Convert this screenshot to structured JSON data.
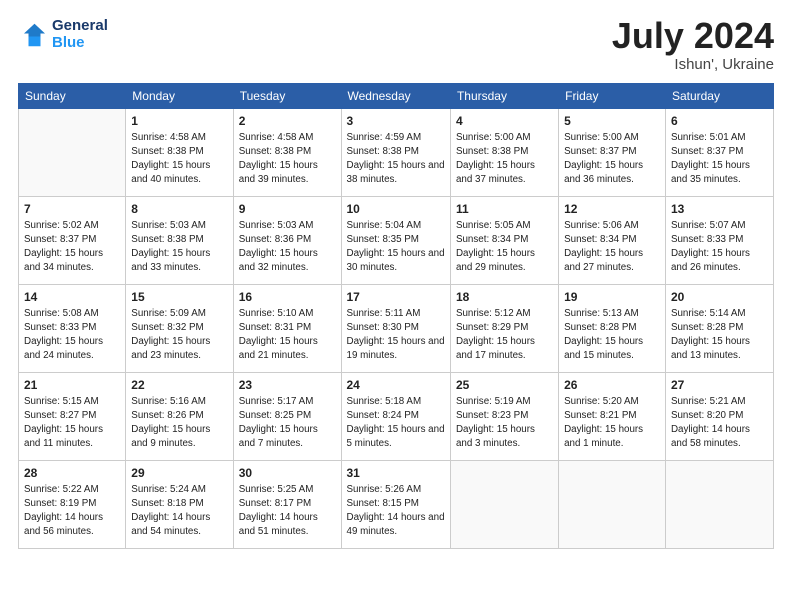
{
  "header": {
    "logo_line1": "General",
    "logo_line2": "Blue",
    "month": "July 2024",
    "location": "Ishun', Ukraine"
  },
  "weekdays": [
    "Sunday",
    "Monday",
    "Tuesday",
    "Wednesday",
    "Thursday",
    "Friday",
    "Saturday"
  ],
  "weeks": [
    [
      {
        "day": "",
        "empty": true
      },
      {
        "day": "1",
        "sunrise": "4:58 AM",
        "sunset": "8:38 PM",
        "daylight": "15 hours and 40 minutes."
      },
      {
        "day": "2",
        "sunrise": "4:58 AM",
        "sunset": "8:38 PM",
        "daylight": "15 hours and 39 minutes."
      },
      {
        "day": "3",
        "sunrise": "4:59 AM",
        "sunset": "8:38 PM",
        "daylight": "15 hours and 38 minutes."
      },
      {
        "day": "4",
        "sunrise": "5:00 AM",
        "sunset": "8:38 PM",
        "daylight": "15 hours and 37 minutes."
      },
      {
        "day": "5",
        "sunrise": "5:00 AM",
        "sunset": "8:37 PM",
        "daylight": "15 hours and 36 minutes."
      },
      {
        "day": "6",
        "sunrise": "5:01 AM",
        "sunset": "8:37 PM",
        "daylight": "15 hours and 35 minutes."
      }
    ],
    [
      {
        "day": "7",
        "sunrise": "5:02 AM",
        "sunset": "8:37 PM",
        "daylight": "15 hours and 34 minutes."
      },
      {
        "day": "8",
        "sunrise": "5:03 AM",
        "sunset": "8:38 PM",
        "daylight": "15 hours and 33 minutes."
      },
      {
        "day": "9",
        "sunrise": "5:03 AM",
        "sunset": "8:36 PM",
        "daylight": "15 hours and 32 minutes."
      },
      {
        "day": "10",
        "sunrise": "5:04 AM",
        "sunset": "8:35 PM",
        "daylight": "15 hours and 30 minutes."
      },
      {
        "day": "11",
        "sunrise": "5:05 AM",
        "sunset": "8:34 PM",
        "daylight": "15 hours and 29 minutes."
      },
      {
        "day": "12",
        "sunrise": "5:06 AM",
        "sunset": "8:34 PM",
        "daylight": "15 hours and 27 minutes."
      },
      {
        "day": "13",
        "sunrise": "5:07 AM",
        "sunset": "8:33 PM",
        "daylight": "15 hours and 26 minutes."
      }
    ],
    [
      {
        "day": "14",
        "sunrise": "5:08 AM",
        "sunset": "8:33 PM",
        "daylight": "15 hours and 24 minutes."
      },
      {
        "day": "15",
        "sunrise": "5:09 AM",
        "sunset": "8:32 PM",
        "daylight": "15 hours and 23 minutes."
      },
      {
        "day": "16",
        "sunrise": "5:10 AM",
        "sunset": "8:31 PM",
        "daylight": "15 hours and 21 minutes."
      },
      {
        "day": "17",
        "sunrise": "5:11 AM",
        "sunset": "8:30 PM",
        "daylight": "15 hours and 19 minutes."
      },
      {
        "day": "18",
        "sunrise": "5:12 AM",
        "sunset": "8:29 PM",
        "daylight": "15 hours and 17 minutes."
      },
      {
        "day": "19",
        "sunrise": "5:13 AM",
        "sunset": "8:28 PM",
        "daylight": "15 hours and 15 minutes."
      },
      {
        "day": "20",
        "sunrise": "5:14 AM",
        "sunset": "8:28 PM",
        "daylight": "15 hours and 13 minutes."
      }
    ],
    [
      {
        "day": "21",
        "sunrise": "5:15 AM",
        "sunset": "8:27 PM",
        "daylight": "15 hours and 11 minutes."
      },
      {
        "day": "22",
        "sunrise": "5:16 AM",
        "sunset": "8:26 PM",
        "daylight": "15 hours and 9 minutes."
      },
      {
        "day": "23",
        "sunrise": "5:17 AM",
        "sunset": "8:25 PM",
        "daylight": "15 hours and 7 minutes."
      },
      {
        "day": "24",
        "sunrise": "5:18 AM",
        "sunset": "8:24 PM",
        "daylight": "15 hours and 5 minutes."
      },
      {
        "day": "25",
        "sunrise": "5:19 AM",
        "sunset": "8:23 PM",
        "daylight": "15 hours and 3 minutes."
      },
      {
        "day": "26",
        "sunrise": "5:20 AM",
        "sunset": "8:21 PM",
        "daylight": "15 hours and 1 minute."
      },
      {
        "day": "27",
        "sunrise": "5:21 AM",
        "sunset": "8:20 PM",
        "daylight": "14 hours and 58 minutes."
      }
    ],
    [
      {
        "day": "28",
        "sunrise": "5:22 AM",
        "sunset": "8:19 PM",
        "daylight": "14 hours and 56 minutes."
      },
      {
        "day": "29",
        "sunrise": "5:24 AM",
        "sunset": "8:18 PM",
        "daylight": "14 hours and 54 minutes."
      },
      {
        "day": "30",
        "sunrise": "5:25 AM",
        "sunset": "8:17 PM",
        "daylight": "14 hours and 51 minutes."
      },
      {
        "day": "31",
        "sunrise": "5:26 AM",
        "sunset": "8:15 PM",
        "daylight": "14 hours and 49 minutes."
      },
      {
        "day": "",
        "empty": true
      },
      {
        "day": "",
        "empty": true
      },
      {
        "day": "",
        "empty": true
      }
    ]
  ]
}
